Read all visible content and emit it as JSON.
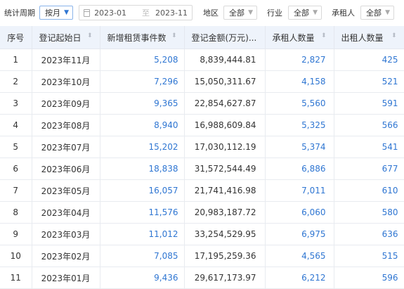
{
  "filters": {
    "period_label": "统计周期",
    "period_value": "按月",
    "date_start": "2023-01",
    "date_sep": "至",
    "date_end": "2023-11",
    "region_label": "地区",
    "region_value": "全部",
    "industry_label": "行业",
    "industry_value": "全部",
    "lessee_label": "承租人",
    "lessee_value": "全部"
  },
  "table": {
    "headers": [
      "序号",
      "登记起始日",
      "新增租赁事件数",
      "登记金额(万元)...",
      "承租人数量",
      "出租人数量"
    ],
    "rows": [
      [
        "1",
        "2023年11月",
        "5,208",
        "8,839,444.81",
        "2,827",
        "425"
      ],
      [
        "2",
        "2023年10月",
        "7,296",
        "15,050,311.67",
        "4,158",
        "521"
      ],
      [
        "3",
        "2023年09月",
        "9,365",
        "22,854,627.87",
        "5,560",
        "591"
      ],
      [
        "4",
        "2023年08月",
        "8,940",
        "16,988,609.84",
        "5,325",
        "566"
      ],
      [
        "5",
        "2023年07月",
        "15,202",
        "17,030,112.19",
        "5,374",
        "541"
      ],
      [
        "6",
        "2023年06月",
        "18,838",
        "31,572,544.49",
        "6,886",
        "677"
      ],
      [
        "7",
        "2023年05月",
        "16,057",
        "21,741,416.98",
        "7,011",
        "610"
      ],
      [
        "8",
        "2023年04月",
        "11,576",
        "20,983,187.72",
        "6,060",
        "580"
      ],
      [
        "9",
        "2023年03月",
        "11,012",
        "33,254,529.95",
        "6,975",
        "636"
      ],
      [
        "10",
        "2023年02月",
        "7,085",
        "17,195,259.36",
        "4,565",
        "515"
      ],
      [
        "11",
        "2023年01月",
        "9,436",
        "29,617,173.97",
        "6,212",
        "596"
      ]
    ]
  },
  "colors": {
    "link": "#2f76d2",
    "header_bg": "#eef3fb",
    "border": "#e8ebf0"
  },
  "icons": {
    "caret": "caret-down-icon",
    "calendar": "calendar-icon",
    "sort": "sort-icon"
  }
}
